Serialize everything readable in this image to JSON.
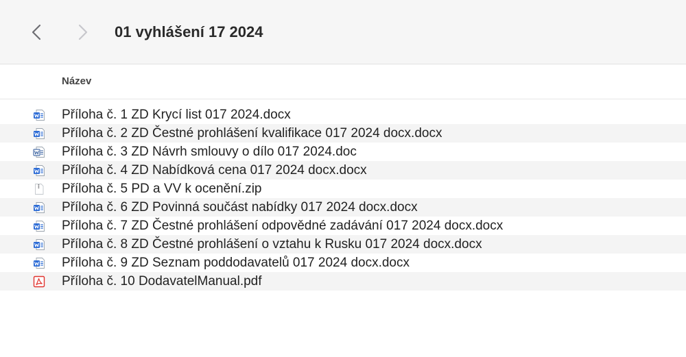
{
  "window": {
    "title": "01 vyhlášení 17 2024"
  },
  "columns": {
    "name_label": "Název"
  },
  "files": [
    {
      "name": "Příloha č. 1 ZD Krycí list 017 2024.docx",
      "icon": "word-document-icon"
    },
    {
      "name": "Příloha č. 2 ZD Čestné prohlášení  kvalifikace  017 2024 docx.docx",
      "icon": "word-document-icon"
    },
    {
      "name": "Příloha č. 3 ZD Návrh smlouvy o dílo 017 2024.doc",
      "icon": "word-legacy-document-icon"
    },
    {
      "name": "Příloha č. 4 ZD Nabídková cena 017 2024 docx.docx",
      "icon": "word-document-icon"
    },
    {
      "name": "Příloha č. 5 PD a VV k ocenění.zip",
      "icon": "zip-archive-icon"
    },
    {
      "name": "Příloha č. 6 ZD Povinná součást nabídky  017 2024 docx.docx",
      "icon": "word-document-icon"
    },
    {
      "name": "Příloha č. 7 ZD Čestné prohlášení odpovědné zadávání  017 2024 docx.docx",
      "icon": "word-document-icon"
    },
    {
      "name": "Příloha č. 8 ZD Čestné prohlášení o vztahu k Rusku  017 2024 docx.docx",
      "icon": "word-document-icon"
    },
    {
      "name": "Příloha č. 9 ZD Seznam poddodavatelů  017 2024 docx.docx",
      "icon": "word-document-icon"
    },
    {
      "name": "Příloha č. 10 DodavatelManual.pdf",
      "icon": "pdf-document-icon"
    }
  ],
  "colors": {
    "word_blue": "#2b6bd6",
    "pdf_red": "#e0332f",
    "nav_active": "#6e6e73",
    "nav_inactive": "#c7c7cc"
  }
}
